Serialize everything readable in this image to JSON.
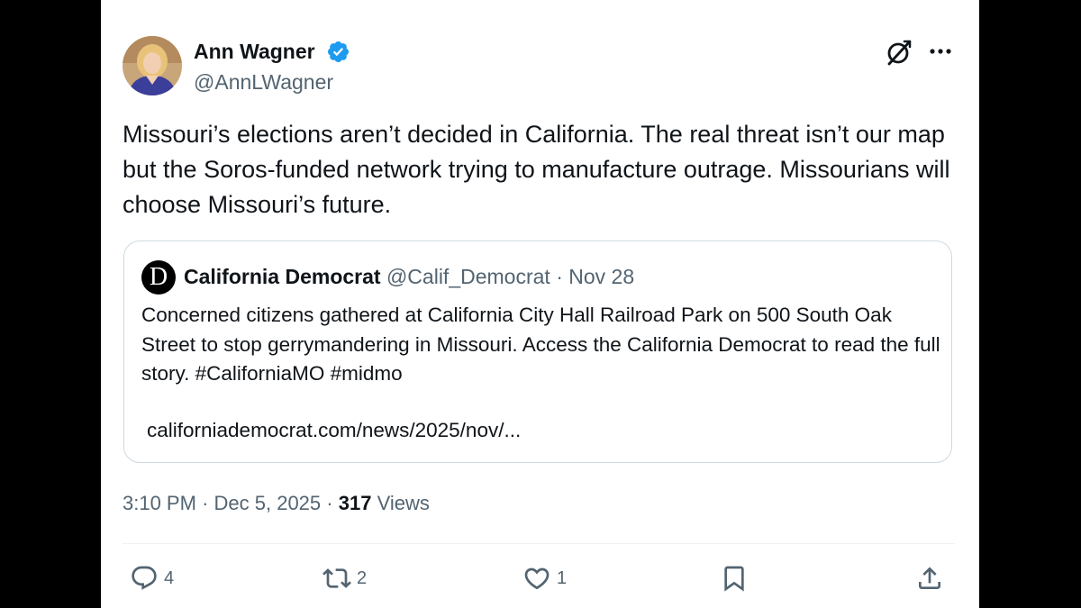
{
  "author": {
    "display_name": "Ann Wagner",
    "handle": "@AnnLWagner",
    "verified_icon": "verified-badge-icon",
    "verified_color": "#1d9bf0"
  },
  "tweet": {
    "text": "Missouri’s elections aren’t decided in California. The real threat isn’t our map but the Soros-funded network trying to manufacture outrage. Missourians will choose Missouri’s future."
  },
  "quote": {
    "logo_letter": "D",
    "name": "California Democrat",
    "handle": "@Calif_Democrat",
    "separator": "·",
    "date": "Nov 28",
    "text": "Concerned citizens gathered at California City Hall Railroad Park on 500 South Oak Street to stop gerrymandering in Missouri. Access the California Democrat to read the full story. #CaliforniaMO #midmo",
    "link": "californiademocrat.com/news/2025/nov/..."
  },
  "meta": {
    "time": "3:10 PM",
    "sep1": "·",
    "date": "Dec 5, 2025",
    "sep2": "·",
    "views_count": "317",
    "views_label": "Views"
  },
  "actions": {
    "replies": "4",
    "reposts": "2",
    "likes": "1"
  },
  "colors": {
    "text_primary": "#0f1419",
    "text_secondary": "#536471",
    "border": "#cfd9de",
    "background_outer": "#000000"
  }
}
